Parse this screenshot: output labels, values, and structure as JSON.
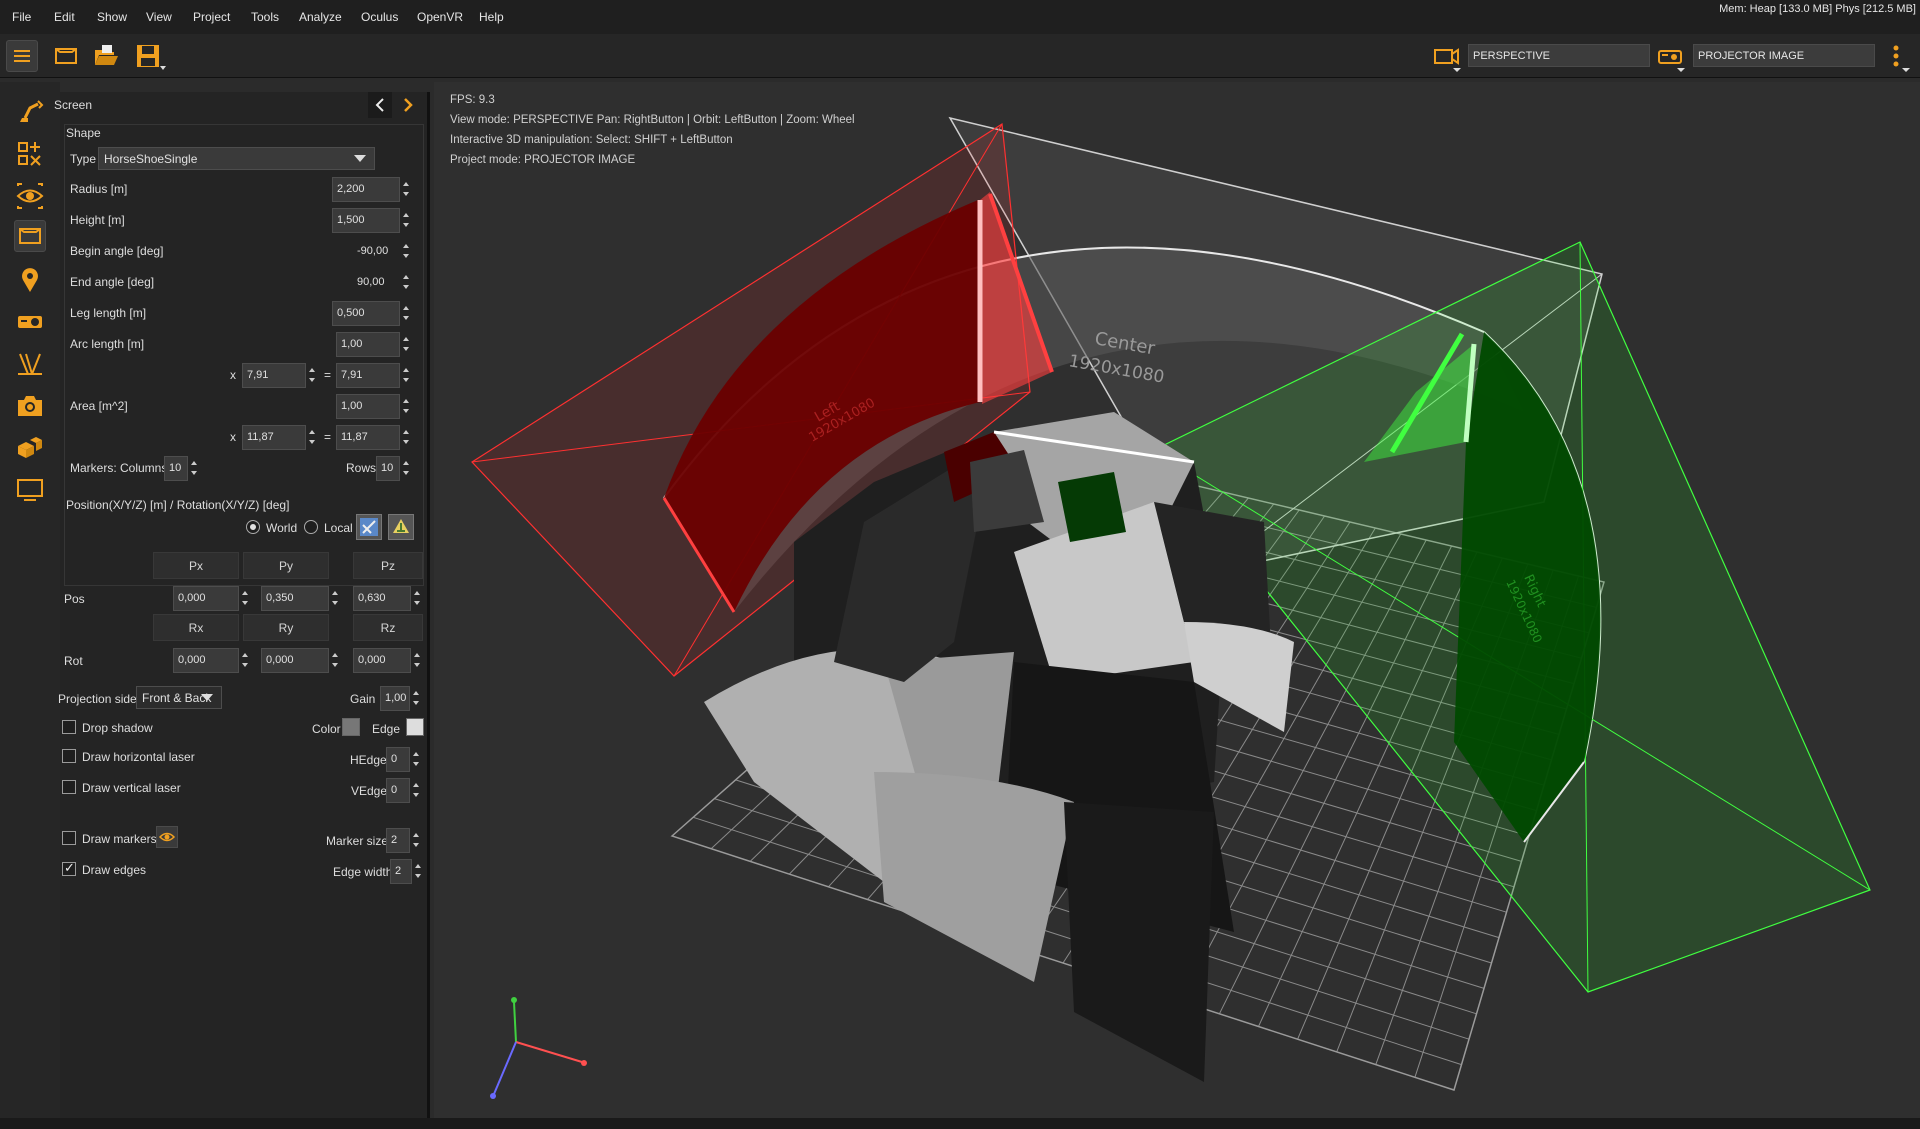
{
  "menu": [
    "File",
    "Edit",
    "Show",
    "View",
    "Project",
    "Tools",
    "Analyze",
    "Oculus",
    "OpenVR",
    "Help"
  ],
  "mem_status": "Mem: Heap [133.0 MB] Phys [212.5 MB]",
  "toolbar": {
    "view_mode_value": "PERSPECTIVE",
    "project_mode_value": "PROJECTOR IMAGE"
  },
  "panel": {
    "title": "Screen",
    "shape_group": "Shape",
    "type_label": "Type",
    "type_value": "HorseShoeSingle",
    "radius_label": "Radius   [m]",
    "radius_value": "2,200",
    "height_label": "Height   [m]",
    "height_value": "1,500",
    "begin_angle_label": "Begin angle [deg]",
    "begin_angle_value": "-90,00",
    "end_angle_label": "End angle [deg]",
    "end_angle_value": "90,00",
    "leg_length_label": "Leg length   [m]",
    "leg_length_value": "0,500",
    "arc_length_label": "Arc length   [m]",
    "arc_length_value": "1,00",
    "arc_x_label": "x",
    "arc_x_value": "7,91",
    "arc_eq_label": "=",
    "arc_eq_value": "7,91",
    "area_label": "Area   [m^2]",
    "area_value": "1,00",
    "area_x_label": "x",
    "area_x_value": "11,87",
    "area_eq_label": "=",
    "area_eq_value": "11,87",
    "markers_label": "Markers:  Columns",
    "markers_columns": "10",
    "rows_label": "Rows",
    "rows_value": "10",
    "position_group": "Position(X/Y/Z) [m] / Rotation(X/Y/Z) [deg]",
    "world_label": "World",
    "local_label": "Local",
    "px": "Px",
    "py": "Py",
    "pz": "Pz",
    "pos_label": "Pos",
    "pos_x": "0,000",
    "pos_y": "0,350",
    "pos_z": "0,630",
    "rx": "Rx",
    "ry": "Ry",
    "rz": "Rz",
    "rot_label": "Rot",
    "rot_x": "0,000",
    "rot_y": "0,000",
    "rot_z": "0,000",
    "projection_side_label": "Projection side",
    "projection_side_value": "Front & Back",
    "gain_label": "Gain",
    "gain_value": "1,00",
    "drop_shadow_label": "Drop shadow",
    "color_label": "Color",
    "edge_label": "Edge",
    "draw_h_laser_label": "Draw horizontal laser",
    "hedge_label": "HEdge",
    "hedge_value": "0",
    "draw_v_laser_label": "Draw vertical laser",
    "vedge_label": "VEdge",
    "vedge_value": "0",
    "draw_markers_label": "Draw markers",
    "marker_size_label": "Marker size",
    "marker_size_value": "2",
    "draw_edges_label": "Draw edges",
    "edge_width_label": "Edge width",
    "edge_width_value": "2"
  },
  "viewport": {
    "fps": "FPS: 9.3",
    "view_mode_line": "View mode: PERSPECTIVE Pan: RightButton | Orbit: LeftButton | Zoom: Wheel",
    "manip_line": "Interactive 3D manipulation: Select: SHIFT + LeftButton",
    "project_mode_line": "Project mode: PROJECTOR IMAGE",
    "center_label": "Center",
    "center_res": "1920x1080",
    "left_label": "Left",
    "left_res": "1920x1080",
    "right_label": "Right",
    "right_res": "1920x1080"
  },
  "colors": {
    "accent": "#f0a020",
    "left_projector": "#ff3030",
    "right_projector": "#30ff30",
    "background": "#2f2f2f"
  }
}
